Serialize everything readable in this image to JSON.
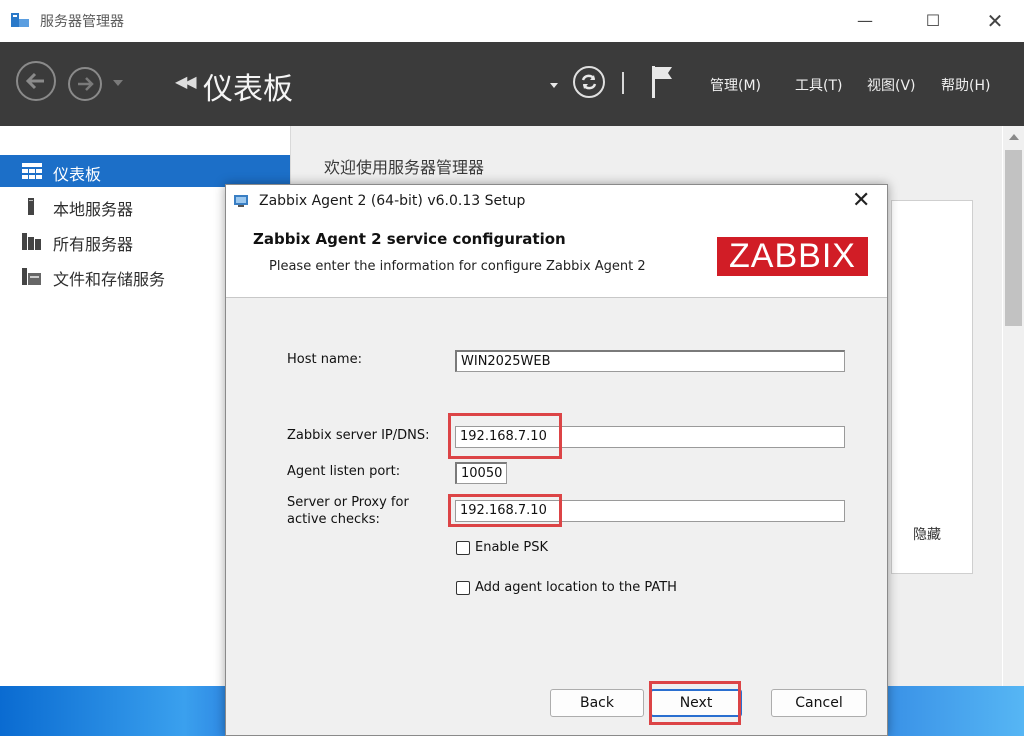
{
  "window": {
    "title": "服务器管理器"
  },
  "header": {
    "breadcrumb_title": "仪表板",
    "menu": [
      "管理(M)",
      "工具(T)",
      "视图(V)",
      "帮助(H)"
    ]
  },
  "sidebar": {
    "items": [
      {
        "label": "仪表板",
        "icon": "dashboard-icon",
        "active": true
      },
      {
        "label": "本地服务器",
        "icon": "server-icon",
        "active": false
      },
      {
        "label": "所有服务器",
        "icon": "servers-icon",
        "active": false
      },
      {
        "label": "文件和存储服务",
        "icon": "storage-icon",
        "active": false
      }
    ]
  },
  "content": {
    "welcome": "欢迎使用服务器管理器",
    "hide_label": "隐藏"
  },
  "dialog": {
    "title": "Zabbix Agent 2 (64-bit) v6.0.13 Setup",
    "heading": "Zabbix Agent 2 service configuration",
    "subheading": "Please enter the information for configure Zabbix Agent 2",
    "logo_text": "ZABBIX",
    "fields": {
      "host_name": {
        "label": "Host name:",
        "value": "WIN2025WEB"
      },
      "server_ip": {
        "label": "Zabbix server IP/DNS:",
        "value": "192.168.7.10"
      },
      "listen_port": {
        "label": "Agent listen port:",
        "value": "10050"
      },
      "active_checks": {
        "label_line1": "Server or Proxy for",
        "label_line2": "active checks:",
        "value": "192.168.7.10"
      }
    },
    "checkboxes": {
      "enable_psk": {
        "label": "Enable PSK",
        "checked": false
      },
      "add_path": {
        "label": "Add agent location to the PATH",
        "checked": false
      }
    },
    "buttons": {
      "back": "Back",
      "next": "Next",
      "cancel": "Cancel"
    }
  },
  "colors": {
    "highlight": "#dc4446",
    "accent": "#1c6fc8",
    "brand": "#d11d26",
    "header_bg": "#3b3b3b"
  }
}
